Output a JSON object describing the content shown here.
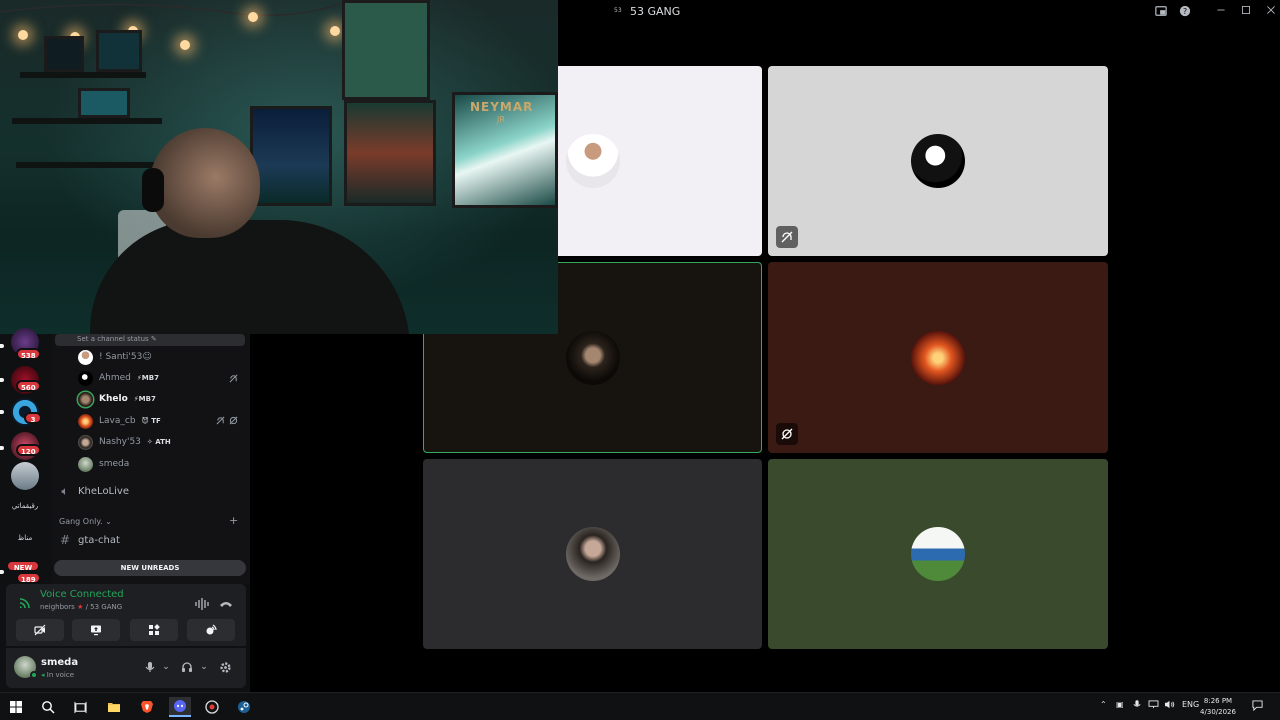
{
  "window": {
    "server_glyph": "53",
    "title": "53 GANG",
    "icons": [
      "screen-share-popout-icon",
      "help-icon",
      "minimize-icon",
      "maximize-icon",
      "close-icon"
    ]
  },
  "camera": {
    "poster_text": "NEYMAR",
    "poster_sub": "JR"
  },
  "voice_tiles": [
    {
      "name": "tile-user-1",
      "bg": "#f2f0f5",
      "muted": false,
      "highlighted": false
    },
    {
      "name": "tile-user-2",
      "bg": "#d6d6d6",
      "muted": true,
      "highlighted": false
    },
    {
      "name": "tile-user-3",
      "bg": "#17130f",
      "muted": false,
      "highlighted": true
    },
    {
      "name": "tile-user-4",
      "bg": "#3b1a14",
      "muted": true,
      "highlighted": false
    },
    {
      "name": "tile-user-5",
      "bg": "#2c2c2f",
      "muted": false,
      "highlighted": false
    },
    {
      "name": "tile-user-6",
      "bg": "#3a4a2c",
      "muted": false,
      "highlighted": false
    }
  ],
  "guilds": {
    "badges": [
      "538",
      "560",
      "3",
      "120",
      "NEW",
      "189"
    ],
    "server_text_1": "رقيقماتي",
    "server_text_2": "مناظ"
  },
  "channel_status_placeholder": "Set a channel status",
  "members": [
    {
      "name": "! Santi'53☺",
      "tag": ""
    },
    {
      "name": "Ahmed",
      "tag": "⚡MB7"
    },
    {
      "name": "Khelo",
      "tag": "⚡MB7"
    },
    {
      "name": "Lava_cb",
      "tag": "😈 TF"
    },
    {
      "name": "Nashy'53",
      "tag": "✧ ATH"
    },
    {
      "name": "smeda",
      "tag": ""
    }
  ],
  "voice_channel_2": "KheLoLive",
  "category": "Gang Only.",
  "text_channel": "gta-chat",
  "new_unreads": "NEW UNREADS",
  "voice_panel": {
    "status": "Voice Connected",
    "location": "neighbors",
    "server": "/ 53 GANG"
  },
  "user_panel": {
    "username": "smeda",
    "status": "In voice"
  },
  "taskbar": {
    "language": "ENG",
    "time": "8:26 PM",
    "date": "4/30/2026"
  },
  "colors": {
    "voice_green": "#23a55a",
    "badge_red": "#da373c",
    "speaking_green": "#3ba55d"
  }
}
